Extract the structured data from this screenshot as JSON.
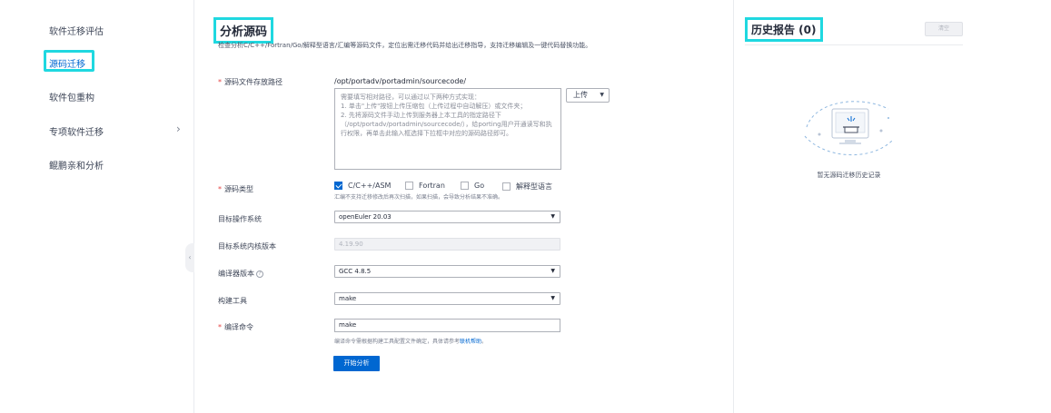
{
  "sidebar": {
    "items": [
      {
        "label": "软件迁移评估"
      },
      {
        "label": "源码迁移"
      },
      {
        "label": "软件包重构"
      },
      {
        "label": "专项软件迁移"
      },
      {
        "label": "鲲鹏亲和分析"
      }
    ],
    "active_index": 1,
    "expand_arrow": "›",
    "collapse_glyph": "‹"
  },
  "main": {
    "title": "分析源码",
    "description": "检查分析C/C++/Fortran/Go/解释型语言/汇编等源码文件，定位出需迁移代码并给出迁移指导，支持迁移编辑及一键代码替换功能。",
    "source_path": {
      "label": "源码文件存放路径",
      "prefix": "/opt/portadv/portadmin/sourcecode/",
      "placeholder": "需要填写相对路径，可以通过以下两种方式实现：\n1. 单击\"上传\"按钮上传压缩包（上传过程中自动解压）或文件夹；\n2. 先将源码文件手动上传到服务器上本工具的指定路径下（/opt/portadv/portadmin/sourcecode/），给porting用户开通读写和执行权限，再单击此输入框选择下拉框中对应的源码路径即可。",
      "upload_label": "上传"
    },
    "source_type": {
      "label": "源码类型",
      "options": [
        {
          "label": "C/C++/ASM",
          "checked": true
        },
        {
          "label": "Fortran",
          "checked": false
        },
        {
          "label": "Go",
          "checked": false
        },
        {
          "label": "解释型语言",
          "checked": false
        }
      ],
      "note": "汇编不支持迁移修改后再次扫描，如果扫描，会导致分析结果不准确。"
    },
    "target_os": {
      "label": "目标操作系统",
      "value": "openEuler 20.03"
    },
    "kernel_version": {
      "label": "目标系统内核版本",
      "value": "4.19.90"
    },
    "compiler_version": {
      "label": "编译器版本",
      "value": "GCC 4.8.5",
      "help": "?"
    },
    "build_tool": {
      "label": "构建工具",
      "value": "make"
    },
    "compile_command": {
      "label": "编译命令",
      "value": "make",
      "hint_prefix": "编译命令需根据构建工具配置文件确定，具体请参考",
      "hint_link": "联机帮助",
      "hint_suffix": "。"
    },
    "start_button": "开始分析",
    "dropdown_caret": "▼"
  },
  "history": {
    "title": "历史报告 (0)",
    "clear_label": "清空",
    "empty_text": "暂无源码迁移历史记录"
  },
  "colors": {
    "accent": "#0067d1",
    "highlight_box": "#1fd8e0",
    "required": "#e54545"
  }
}
